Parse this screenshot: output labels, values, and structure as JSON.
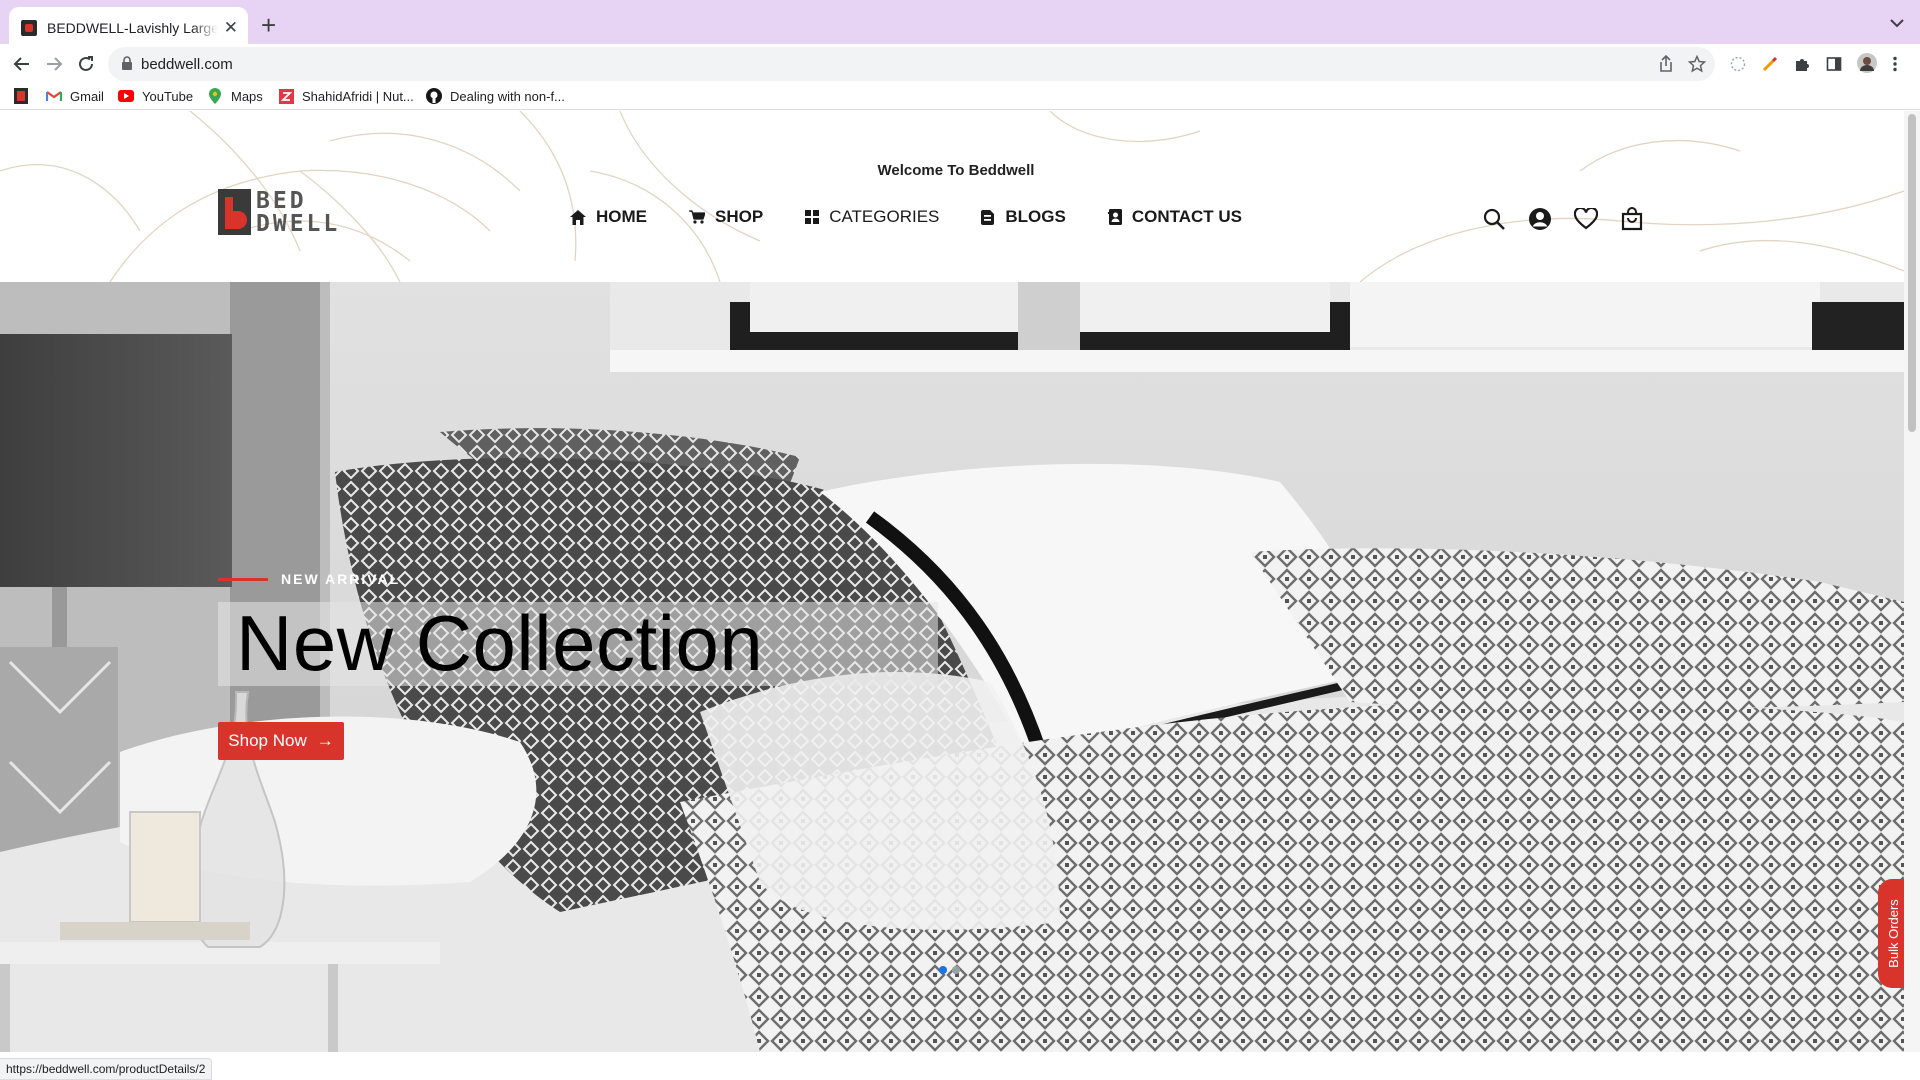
{
  "browser": {
    "tab_title": "BEDDWELL-Lavishly Largest S",
    "new_tab_label": "+",
    "close_label": "✕",
    "url": "beddwell.com",
    "status_url": "https://beddwell.com/productDetails/2",
    "bookmarks": [
      {
        "label": "",
        "icon": "beddwell-favicon-icon"
      },
      {
        "label": "Gmail",
        "icon": "gmail-icon"
      },
      {
        "label": "YouTube",
        "icon": "youtube-icon"
      },
      {
        "label": "Maps",
        "icon": "maps-icon"
      },
      {
        "label": "ShahidAfridi | Nut...",
        "icon": "zomato-icon"
      },
      {
        "label": "Dealing with non-f...",
        "icon": "github-icon"
      }
    ]
  },
  "site": {
    "welcome": "Welcome To Beddwell",
    "logo_top": "BED",
    "logo_bottom": "DWELL",
    "nav": [
      {
        "label": "HOME",
        "icon": "home-icon"
      },
      {
        "label": "SHOP",
        "icon": "cart-icon"
      },
      {
        "label": "CATEGORIES",
        "icon": "grid-icon"
      },
      {
        "label": "BLOGS",
        "icon": "blog-icon"
      },
      {
        "label": "CONTACT US",
        "icon": "contact-icon"
      }
    ],
    "header_icons": [
      "search-icon",
      "account-icon",
      "wishlist-icon",
      "bag-icon"
    ]
  },
  "hero": {
    "eyebrow": "NEW ARRIVAL",
    "headline": "New Collection",
    "cta_label": "Shop Now",
    "cta_arrow": "→",
    "active_slide": 1,
    "slide_count": 2,
    "bulk_label": "Bulk Orders"
  },
  "colors": {
    "brand_red": "#d9342b",
    "tabstrip": "#e7d4f5",
    "dot_active": "#1a73e8"
  }
}
